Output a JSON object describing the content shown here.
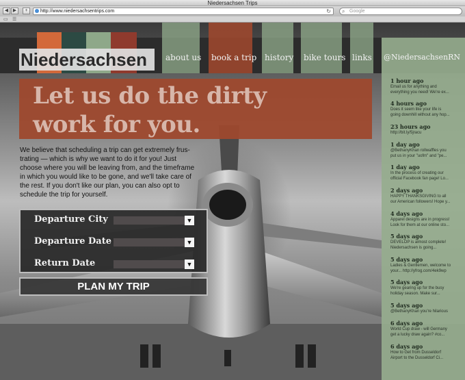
{
  "window": {
    "title": "Niedersachsen Trips"
  },
  "browser": {
    "url": "http://www.niedersachsentrips.com",
    "search_placeholder": "Google",
    "back_icon": "back-arrow-icon",
    "forward_icon": "forward-arrow-icon",
    "add_icon": "plus-icon"
  },
  "site": {
    "logo": "Niedersachsen",
    "nav": [
      "about us",
      "book a trip",
      "history",
      "bike tours",
      "links",
      "@NiedersachsenRN"
    ],
    "active_nav": "book a trip",
    "swatch_colors": [
      "#d3693a",
      "#2c4a43",
      "#8ea889",
      "#8f3a2d"
    ]
  },
  "main": {
    "headline": [
      "Let us do the dirty",
      "work for you."
    ],
    "intro": [
      "We believe that scheduling a trip can get extremely frus-",
      "trating — which is why we want to do it for you! Just",
      "choose where you will be leaving from, and the timeframe",
      "in which you would like to be gone, and we'll take care of",
      "the rest. If you don't like our plan, you can also opt to",
      "schedule the trip for yourself."
    ]
  },
  "form": {
    "fields": [
      "Departure City",
      "Departure Date",
      "Return Date"
    ],
    "submit": "PLAN MY TRIP"
  },
  "tweets": [
    {
      "time": "1 hour ago",
      "lines": [
        "Email us for anything and",
        "everything you need! We're ex..."
      ]
    },
    {
      "time": "4 hours ago",
      "lines": [
        "Does it seem like your life is",
        "going downhill without any hop..."
      ]
    },
    {
      "time": "23 hours ago",
      "lines": [
        "http://bit.ly/5jracu"
      ]
    },
    {
      "time": "1 day ago",
      "lines": [
        "@BethanyKhan rollwaffles you",
        "put us in your \"uofm\" and \"pe..."
      ]
    },
    {
      "time": "1 day ago",
      "lines": [
        "In the process of creating our",
        "official Facebook fan page! Lo..."
      ]
    },
    {
      "time": "2 days ago",
      "lines": [
        "HAPPY THANKSGIVING to all",
        "our American followers! Hope y..."
      ]
    },
    {
      "time": "4 days ago",
      "lines": [
        "Apparel designs are in progress!",
        "Look for them at our online sto..."
      ]
    },
    {
      "time": "5 days ago",
      "lines": [
        "DEVELOP is almost complete!",
        "Niedersachsen is going..."
      ]
    },
    {
      "time": "5 days ago",
      "lines": [
        "Ladies & Gentlemen, welcome to",
        "your...  http://yfrog.com/4ek9wp"
      ]
    },
    {
      "time": "5 days ago",
      "lines": [
        "We're gearing up for the busy",
        "holiday season. Make sur..."
      ]
    },
    {
      "time": "5 days ago",
      "lines": [
        "@BethanyKhan you're hilarious"
      ]
    },
    {
      "time": "6 days ago",
      "lines": [
        "World Cup draw - will Germany",
        "get a lucky draw again? #co..."
      ]
    },
    {
      "time": "6 days ago",
      "lines": [
        "How to Get from Dusseldorf",
        "Airport to the Dusseldorf Ci..."
      ]
    }
  ]
}
